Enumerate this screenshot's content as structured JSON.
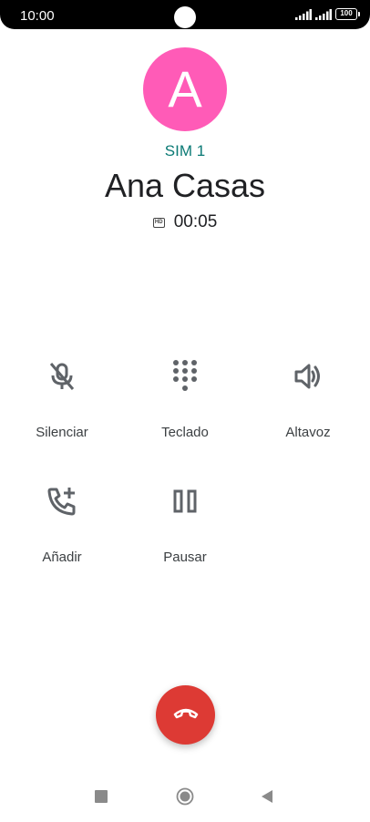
{
  "status_bar": {
    "time": "10:00",
    "battery": "100",
    "icons": [
      "signal-icon",
      "signal-icon",
      "battery-icon"
    ]
  },
  "contact": {
    "avatar_letter": "A",
    "avatar_color": "#ff5bb7",
    "sim": "SIM 1",
    "name": "Ana Casas",
    "duration": "00:05",
    "hd_badge": "HD"
  },
  "actions": [
    {
      "label": "Silenciar",
      "icon": "mic-off-icon"
    },
    {
      "label": "Teclado",
      "icon": "dialpad-icon"
    },
    {
      "label": "Altavoz",
      "icon": "speaker-icon"
    },
    {
      "label": "Añadir",
      "icon": "add-call-icon"
    },
    {
      "label": "Pausar",
      "icon": "pause-icon"
    }
  ],
  "colors": {
    "accent": "#0b7a75",
    "end_call": "#dd3a34",
    "icon": "#5f6368"
  },
  "nav": {
    "icons": [
      "recents-icon",
      "home-icon",
      "back-icon"
    ]
  }
}
